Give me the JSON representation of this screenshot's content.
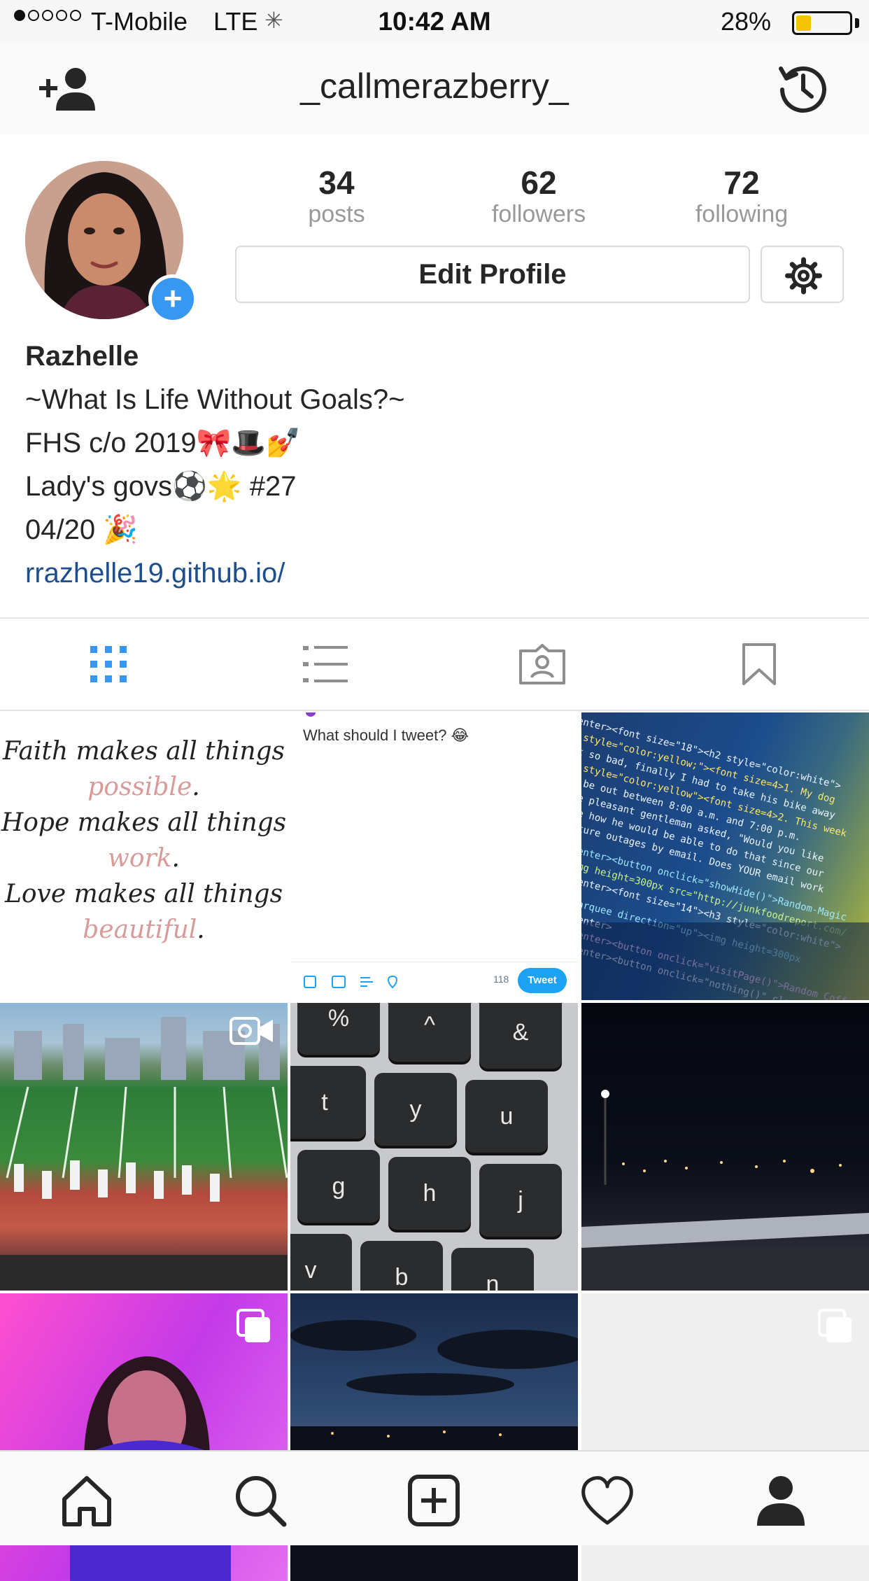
{
  "status_bar": {
    "carrier": "T-Mobile",
    "network": "LTE",
    "time": "10:42 AM",
    "battery_percent": "28%",
    "battery_level": 0.28,
    "signal_bars": 1,
    "signal_total": 5
  },
  "header": {
    "username": "_callmerazberry_",
    "left_icon": "add-user-icon",
    "right_icon": "history-icon"
  },
  "profile": {
    "stats": [
      {
        "value": "34",
        "label": "posts"
      },
      {
        "value": "62",
        "label": "followers"
      },
      {
        "value": "72",
        "label": "following"
      }
    ],
    "edit_button": "Edit Profile",
    "settings_icon": "gear-icon",
    "avatar_badge": "+"
  },
  "bio": {
    "name": "Razhelle",
    "lines": [
      "~What Is Life Without Goals?~",
      "FHS c/o 2019🎀🎩💅",
      "Lady's govs⚽🌟 #27",
      "04/20 🎉"
    ],
    "link": "rrazhelle19.github.io/"
  },
  "tabs": [
    "grid-icon",
    "list-icon",
    "tagged-icon",
    "saved-icon"
  ],
  "posts": {
    "quote": {
      "line1": "Faith makes all things",
      "word1": "possible",
      "line2": "Hope makes all things",
      "word2": "work",
      "line3": "Love makes all things",
      "word3": "beautiful",
      "period": "."
    },
    "tweet": {
      "text": "What should I tweet? 😂",
      "count": "118",
      "button": "Tweet"
    }
  },
  "bottom_nav": [
    "home-icon",
    "search-icon",
    "new-post-icon",
    "activity-icon",
    "profile-icon"
  ],
  "colors": {
    "accent": "#3897f0",
    "link": "#1d4f8f",
    "tweet_blue": "#1da1f2"
  }
}
